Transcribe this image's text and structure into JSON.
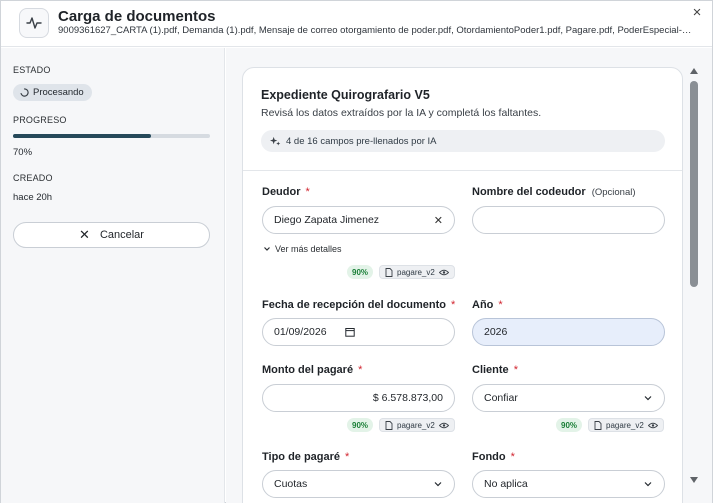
{
  "header": {
    "title": "Carga de documentos",
    "files": "9009361627_CARTA (1).pdf, Demanda (1).pdf, Mensaje de correo otorgamiento de poder.pdf, OtordamientoPoder1.pdf, Pagare.pdf, PoderEspecial-3....",
    "close_label": "×"
  },
  "sidebar": {
    "status_label": "ESTADO",
    "status_value": "Procesando",
    "progress_label": "PROGRESO",
    "progress_value": "70%",
    "progress_fraction": 0.7,
    "created_label": "CREADO",
    "created_value": "hace 20h",
    "cancel_label": "Cancelar"
  },
  "form": {
    "title": "Expediente Quirografario V5",
    "subtitle": "Revisá los datos extraídos por la IA y completá los faltantes.",
    "ai_summary": "4 de 16 campos pre-llenados por IA",
    "required_mark": "*",
    "details_link": "Ver más detalles",
    "fields": {
      "deudor": {
        "label": "Deudor",
        "value": "Diego Zapata Jimenez",
        "confidence": "90%",
        "source": "pagare_v2"
      },
      "codeudor": {
        "label": "Nombre del codeudor",
        "optional": "(Opcional)",
        "value": ""
      },
      "fecha": {
        "label": "Fecha de recepción del documento",
        "value": "01/09/2026"
      },
      "anio": {
        "label": "Año",
        "value": "2026"
      },
      "monto": {
        "label": "Monto del pagaré",
        "value": "$ 6.578.873,00",
        "confidence": "90%",
        "source": "pagare_v2"
      },
      "cliente": {
        "label": "Cliente",
        "value": "Confiar",
        "confidence": "90%",
        "source": "pagare_v2"
      },
      "tipo": {
        "label": "Tipo de pagaré",
        "value": "Cuotas"
      },
      "fondo": {
        "label": "Fondo",
        "value": "No aplica"
      }
    }
  }
}
